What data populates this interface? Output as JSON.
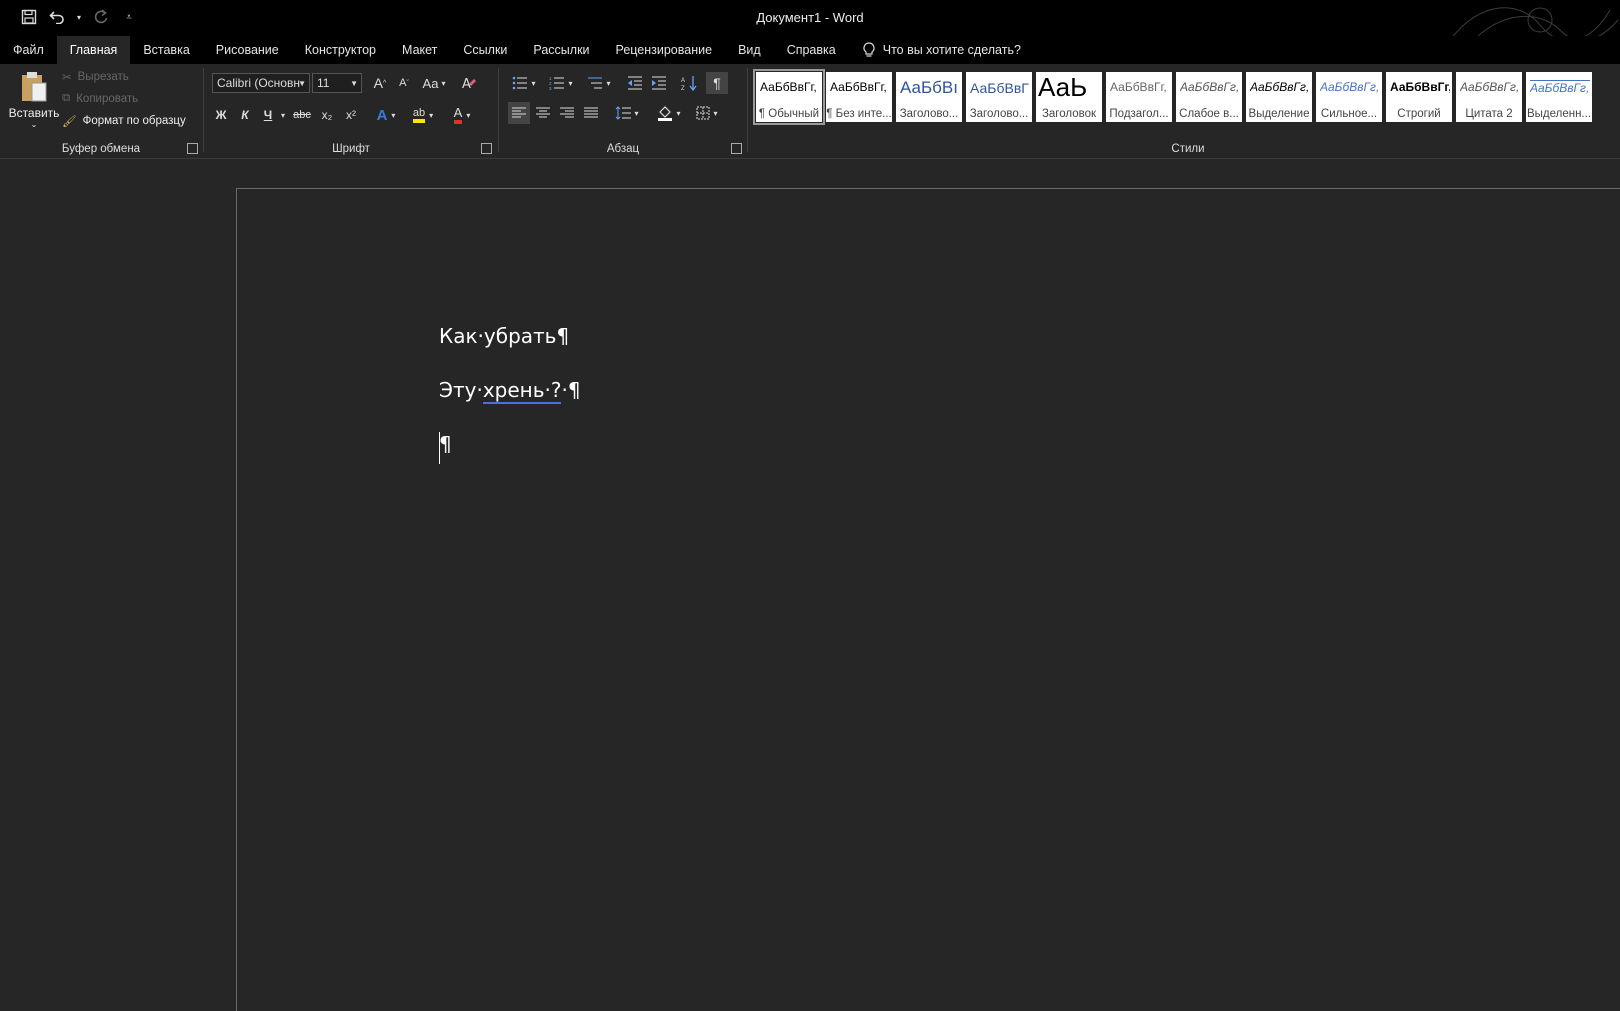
{
  "window": {
    "title": "Документ1  -  Word"
  },
  "qat": {
    "save_icon": "save-icon",
    "undo_icon": "undo-icon",
    "redo_icon": "redo-icon",
    "customize_icon": "customize-icon"
  },
  "tabs": [
    "Файл",
    "Главная",
    "Вставка",
    "Рисование",
    "Конструктор",
    "Макет",
    "Ссылки",
    "Рассылки",
    "Рецензирование",
    "Вид",
    "Справка"
  ],
  "active_tab": "Главная",
  "tell_me": "Что вы хотите сделать?",
  "clipboard": {
    "paste": "Вставить",
    "cut": "Вырезать",
    "copy": "Копировать",
    "format_painter": "Формат по образцу",
    "label": "Буфер обмена"
  },
  "font": {
    "name": "Calibri (Основн",
    "size": "11",
    "grow": "A",
    "shrink": "A",
    "case": "Aa",
    "bold": "Ж",
    "italic": "К",
    "underline": "Ч",
    "strike": "abc",
    "sub": "x₂",
    "sup": "x²",
    "label": "Шрифт"
  },
  "paragraph": {
    "label": "Абзац",
    "pilcrow": "¶"
  },
  "styles": {
    "label": "Стили",
    "items": [
      {
        "sample": "АаБбВвГг,",
        "name": "¶ Обычный"
      },
      {
        "sample": "АаБбВвГг,",
        "name": "¶ Без инте..."
      },
      {
        "sample": "АаБбВı",
        "name": "Заголово..."
      },
      {
        "sample": "АаБбВвГ",
        "name": "Заголово..."
      },
      {
        "sample": "АаЬ",
        "name": "Заголовок"
      },
      {
        "sample": "АаБбВвГг,",
        "name": "Подзагол..."
      },
      {
        "sample": "АаБбВвГг,",
        "name": "Слабое в..."
      },
      {
        "sample": "АаБбВвГг,",
        "name": "Выделение"
      },
      {
        "sample": "АаБбВвГг,",
        "name": "Сильное..."
      },
      {
        "sample": "АаБбВвГг,",
        "name": "Строгий"
      },
      {
        "sample": "АаБбВвГг,",
        "name": "Цитата 2"
      },
      {
        "sample": "АаБбВвГг,",
        "name": "Выделенн..."
      }
    ]
  },
  "document": {
    "line1": "Как·убрать¶",
    "line2_a": "Эту·",
    "line2_b": "хрень·?",
    "line2_c": "·¶",
    "line3": "¶"
  },
  "colors": {
    "accent_highlight": "#ffe600",
    "font_color": "#e03030",
    "spell_underline": "#4a6fd6"
  }
}
